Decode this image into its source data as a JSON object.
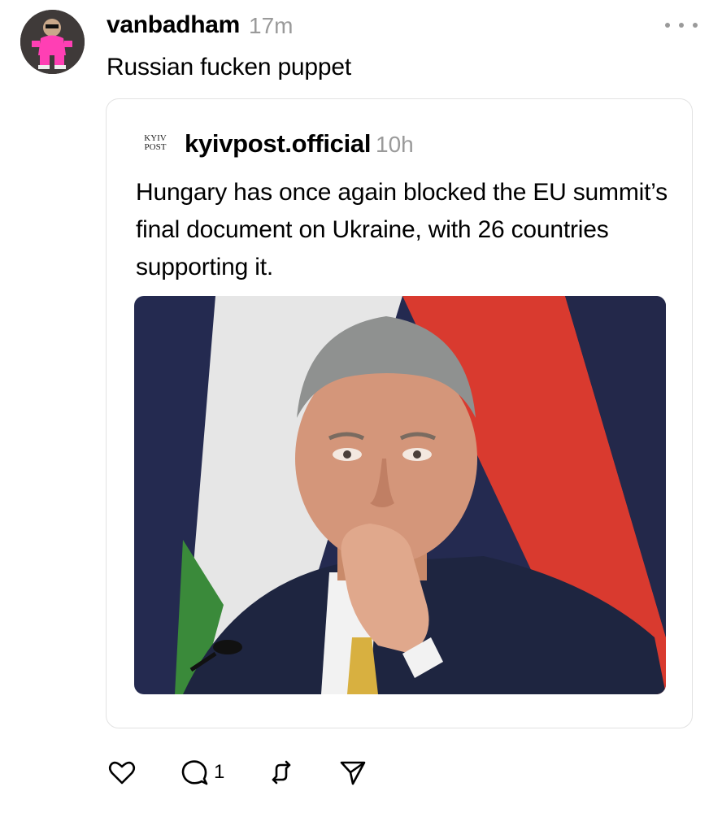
{
  "post": {
    "username": "vanbadham",
    "time": "17m",
    "text": "Russian fucken puppet"
  },
  "quoted_post": {
    "logo_line1": "KYIV",
    "logo_line2": "POST",
    "username": "kyivpost.official",
    "time": "10h",
    "text": "Hungary has once again blocked the EU summit’s final document on Ukraine, with 26 countries supporting it."
  },
  "actions": {
    "reply_count": "1"
  },
  "icons": {
    "more": "more-dots-icon",
    "like": "heart-icon",
    "reply": "comment-bubble-icon",
    "repost": "repost-icon",
    "share": "send-icon"
  },
  "colors": {
    "text": "#000000",
    "muted": "#9a9a9a",
    "border": "#e2e2e2",
    "flag_red": "#d93a2f",
    "flag_white": "#e6e6e6",
    "flag_green": "#3a8a3a",
    "avatar_pink": "#ff3fb4"
  }
}
